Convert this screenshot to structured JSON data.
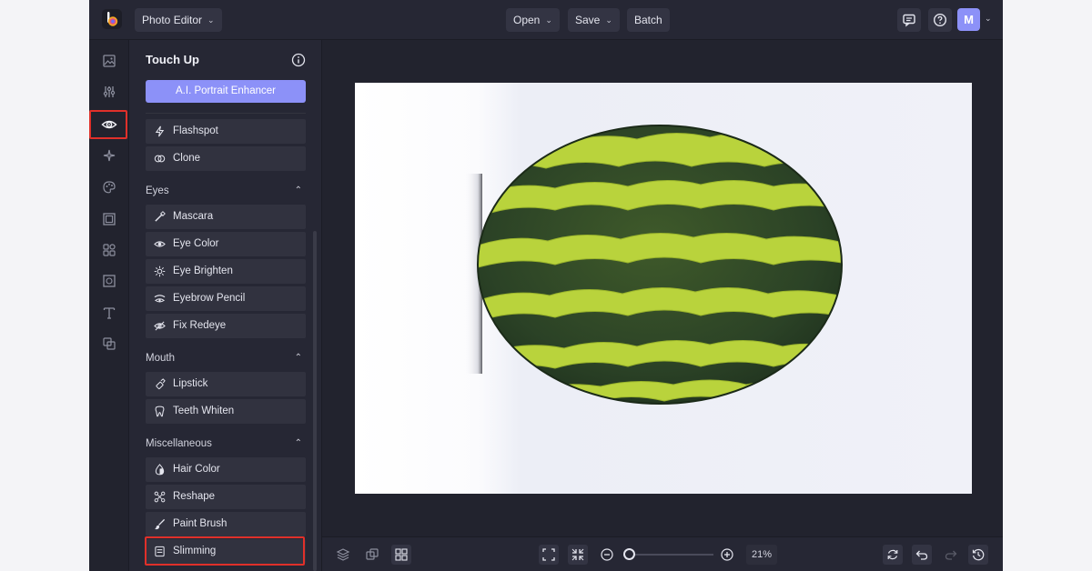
{
  "topbar": {
    "app_title": "Photo Editor",
    "menu": [
      {
        "label": "Open"
      },
      {
        "label": "Save"
      },
      {
        "label": "Batch"
      }
    ],
    "avatar_letter": "M"
  },
  "rail": {
    "icons": [
      "image-icon",
      "sliders-icon",
      "eye-icon",
      "sparkle-icon",
      "palette-icon",
      "frame-icon",
      "shapes-icon",
      "texture-icon",
      "text-icon",
      "layers-icon"
    ],
    "active": "eye-icon"
  },
  "panel": {
    "title": "Touch Up",
    "primary_button": "A.I. Portrait Enhancer",
    "top_tools": [
      {
        "label": "Flashspot",
        "icon": "flash-icon"
      },
      {
        "label": "Clone",
        "icon": "clone-icon"
      }
    ],
    "sections": [
      {
        "title": "Eyes",
        "tools": [
          {
            "label": "Mascara",
            "icon": "mascara-icon"
          },
          {
            "label": "Eye Color",
            "icon": "eye-color-icon"
          },
          {
            "label": "Eye Brighten",
            "icon": "sun-icon"
          },
          {
            "label": "Eyebrow Pencil",
            "icon": "eyebrow-icon"
          },
          {
            "label": "Fix Redeye",
            "icon": "redeye-icon"
          }
        ]
      },
      {
        "title": "Mouth",
        "tools": [
          {
            "label": "Lipstick",
            "icon": "lipstick-icon"
          },
          {
            "label": "Teeth Whiten",
            "icon": "tooth-icon"
          }
        ]
      },
      {
        "title": "Miscellaneous",
        "tools": [
          {
            "label": "Hair Color",
            "icon": "drop-icon"
          },
          {
            "label": "Reshape",
            "icon": "reshape-icon"
          },
          {
            "label": "Paint Brush",
            "icon": "brush-icon"
          },
          {
            "label": "Slimming",
            "icon": "slimming-icon"
          }
        ]
      }
    ],
    "highlighted_tool": "Slimming"
  },
  "bottombar": {
    "zoom": "21%"
  },
  "colors": {
    "accent": "#8c91f8",
    "highlight": "#e0302a",
    "background": "#22232e",
    "panel": "#262734"
  }
}
